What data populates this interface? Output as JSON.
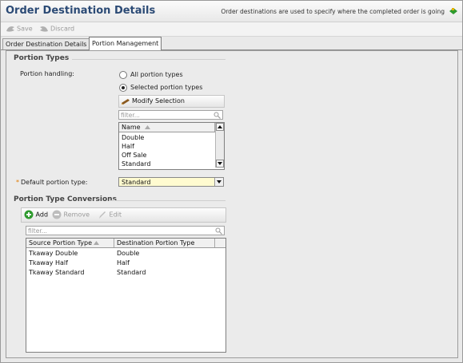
{
  "header": {
    "title": "Order Destination Details",
    "hint": "Order destinations are used to specify where the completed order is going"
  },
  "toolbar": {
    "save_label": "Save",
    "discard_label": "Discard"
  },
  "tabs": [
    {
      "label": "Order Destination Details",
      "active": false
    },
    {
      "label": "Portion Management",
      "active": true
    }
  ],
  "portion_types": {
    "legend": "Portion Types",
    "handling_label": "Portion handling:",
    "options": [
      {
        "label": "All portion types",
        "selected": false
      },
      {
        "label": "Selected portion types",
        "selected": true
      }
    ],
    "modify_label": "Modify Selection",
    "filter_placeholder": "filter...",
    "column_header": "Name",
    "items": [
      "Double",
      "Half",
      "Off Sale",
      "Standard"
    ],
    "default_label": "Default portion type:",
    "default_value": "Standard"
  },
  "conversions": {
    "legend": "Portion Type Conversions",
    "add_label": "Add",
    "remove_label": "Remove",
    "edit_label": "Edit",
    "filter_placeholder": "filter...",
    "columns": [
      "Source Portion Type",
      "Destination Portion Type"
    ],
    "rows": [
      [
        "Tkaway Double",
        "Double"
      ],
      [
        "Tkaway Half",
        "Half"
      ],
      [
        "Tkaway Standard",
        "Standard"
      ]
    ]
  },
  "colors": {
    "title": "#2b4a75",
    "required": "#e07a00",
    "default_select_bg": "#fffbd0",
    "add_green": "#2e9a2e"
  },
  "icons": [
    "save-icon",
    "discard-icon",
    "green-arrow-icon",
    "modify-selection-icon",
    "search-icon",
    "add-icon",
    "remove-icon",
    "edit-icon",
    "sort-arrow-icon",
    "dropdown-arrow-icon"
  ]
}
